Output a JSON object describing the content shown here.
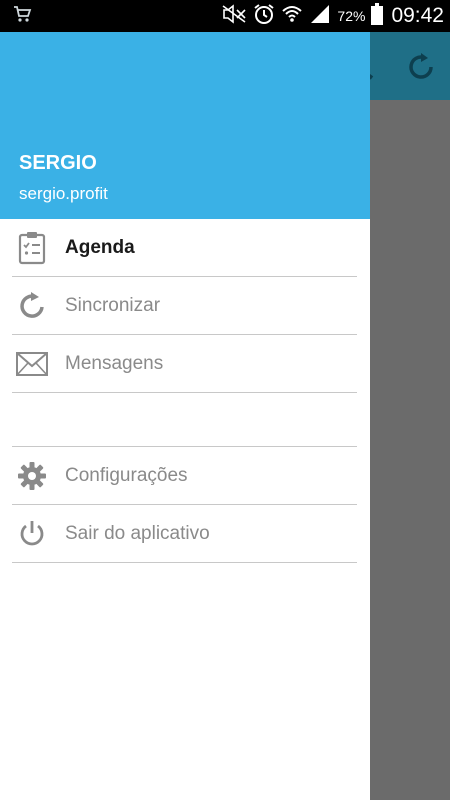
{
  "status_bar": {
    "battery": "72%",
    "time": "09:42",
    "icons": [
      "cart-notification-icon",
      "mute-icon",
      "alarm-icon",
      "wifi-icon",
      "signal-icon",
      "battery-icon"
    ]
  },
  "user": {
    "name": "SERGIO",
    "email": "sergio.profit"
  },
  "menu": {
    "items": [
      {
        "label": "Agenda",
        "icon": "clipboard-checklist-icon",
        "active": true
      },
      {
        "label": "Sincronizar",
        "icon": "sync-icon",
        "active": false
      },
      {
        "label": "Mensagens",
        "icon": "envelope-icon",
        "active": false
      },
      {
        "label": "Configurações",
        "icon": "gear-icon",
        "active": false
      },
      {
        "label": "Sair do aplicativo",
        "icon": "power-icon",
        "active": false
      }
    ]
  },
  "colors": {
    "header": "#3ab1e6",
    "app_toolbar": "#1f6f87",
    "scrim": "#6b6b6b",
    "icon_gray": "#8a8a8a"
  }
}
